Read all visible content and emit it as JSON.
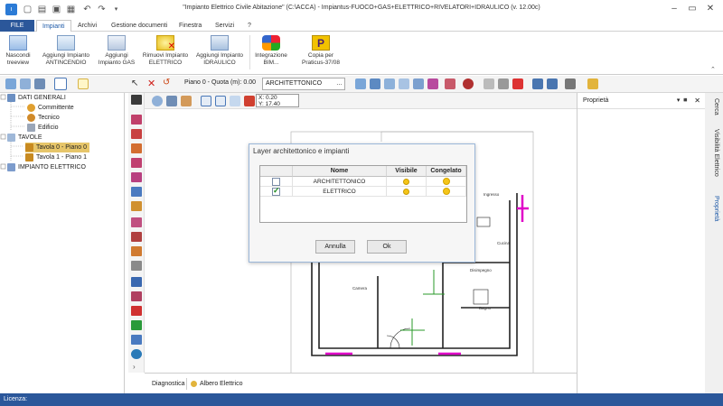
{
  "window": {
    "title": "\"Impianto Elettrico Civile Abitazione\" (C:\\ACCA) - Impiantus-FUOCO+GAS+ELETTRICO+RIVELATORI+IDRAULICO (v. 12.00c)"
  },
  "tabs": [
    "FILE",
    "Impianti",
    "Archivi",
    "Gestione documenti",
    "Finestra",
    "Servizi",
    "?"
  ],
  "ribbon": [
    {
      "label": "Nascondi\ntreeview",
      "icon": "treeview-icon"
    },
    {
      "label": "Aggiungi Impianto\nANTINCENDIO",
      "icon": "sprinkler-icon"
    },
    {
      "label": "Aggiungi\nImpianto GAS",
      "icon": "gas-pipe-icon"
    },
    {
      "label": "Rimuovi Impianto\nELETTRICO",
      "icon": "remove-electric-icon"
    },
    {
      "label": "Aggiungi Impianto\nIDRAULICO",
      "icon": "water-pipe-icon"
    },
    {
      "label": "Integrazione\nBIM...",
      "icon": "bim-icon"
    },
    {
      "label": "Copia per\nPraticus-37/08",
      "icon": "praticus-icon"
    }
  ],
  "toolbar": {
    "level_text": "Piano 0 - Quota (m): 0.00",
    "layer_select": "ARCHITETTONICO"
  },
  "coords": {
    "x": "X: 0.20",
    "y": "Y: 17.40"
  },
  "tree": {
    "items": [
      {
        "label": "DATI GENERALI",
        "level": 0
      },
      {
        "label": "Committente",
        "level": 1
      },
      {
        "label": "Tecnico",
        "level": 1
      },
      {
        "label": "Edificio",
        "level": 1
      },
      {
        "label": "TAVOLE",
        "level": 0
      },
      {
        "label": "Tavola 0 - Piano 0",
        "level": 1,
        "selected": true
      },
      {
        "label": "Tavola 1 - Piano 1",
        "level": 1
      },
      {
        "label": "IMPIANTO ELETTRICO",
        "level": 0
      }
    ]
  },
  "plan_labels": [
    "Ingresso",
    "Cucina",
    "Disimpegno",
    "Bagno",
    "Camera"
  ],
  "bottom_tabs": [
    "Diagnostica",
    "Albero Elettrico"
  ],
  "props": {
    "title": "Proprietà"
  },
  "vertical_tabs": [
    "Cerca",
    "Visibilità Elettrico",
    "Proprietà"
  ],
  "status": {
    "label": "Licenza:"
  },
  "dialog": {
    "title": "Layer architettonico e impianti",
    "columns": [
      "Nome",
      "Visibile",
      "Congelato"
    ],
    "rows": [
      {
        "checked": false,
        "name": "ARCHITETTONICO"
      },
      {
        "checked": true,
        "name": "ELETTRICO"
      }
    ],
    "cancel_label": "Annulla",
    "ok_label": "Ok"
  },
  "colors": {
    "accent": "#2b579a",
    "selection": "#e7c66a",
    "layer_magenta": "#e000c8",
    "layer_green": "#2a9a2a"
  }
}
